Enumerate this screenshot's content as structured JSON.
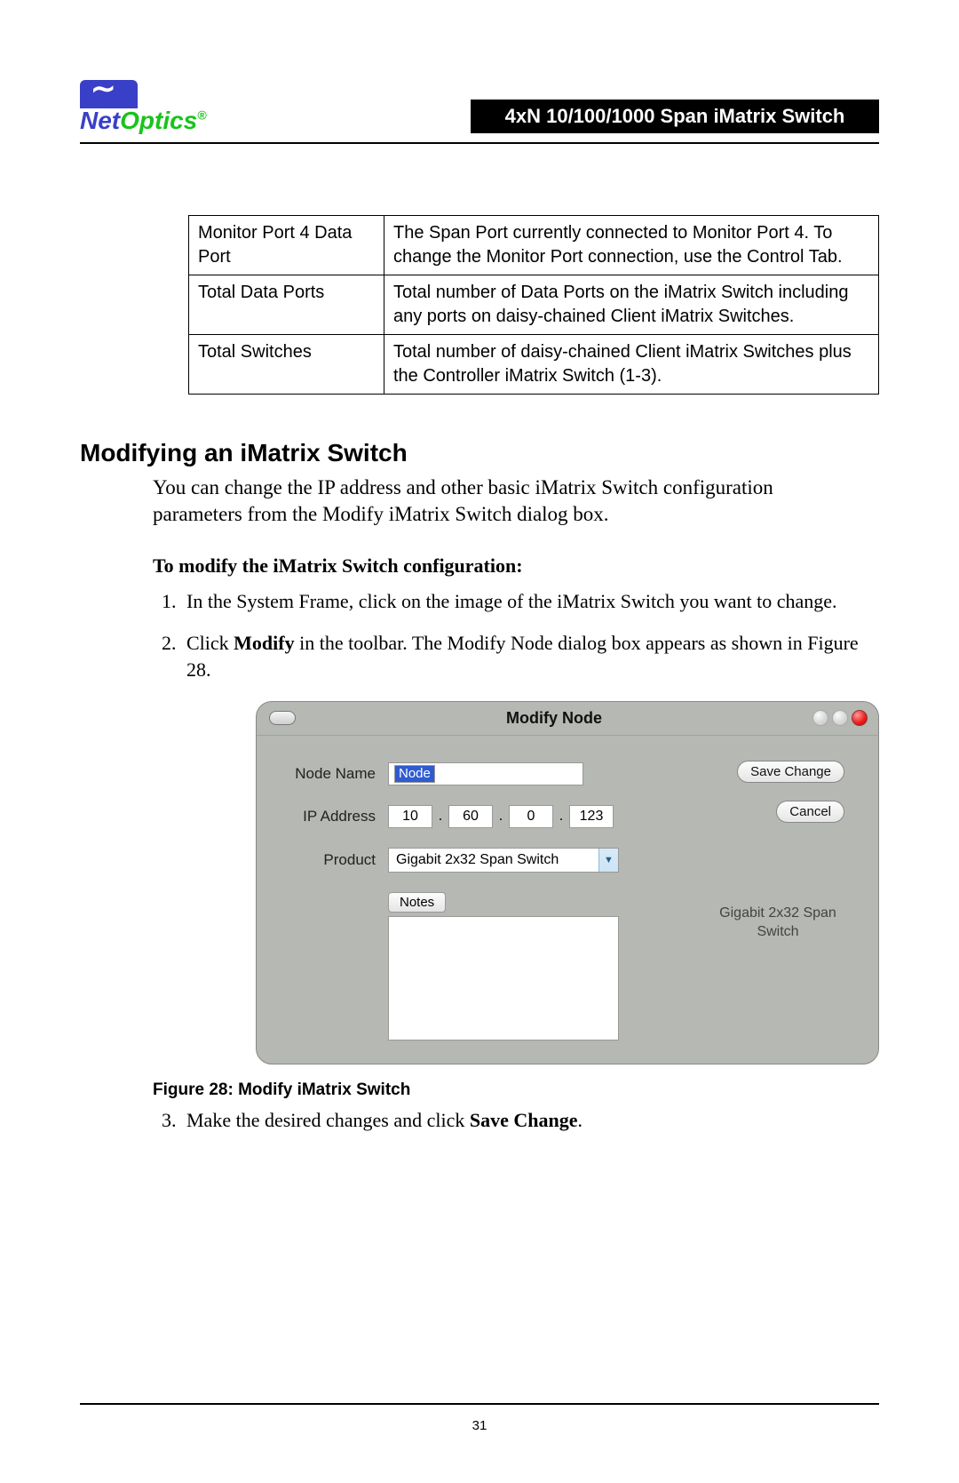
{
  "header": {
    "logo_net": "Net",
    "logo_optics": "Optics",
    "logo_reg": "®",
    "bar_title": "4xN 10/100/1000 Span iMatrix Switch"
  },
  "table": {
    "rows": [
      {
        "left": "Monitor Port 4 Data Port",
        "right": "The Span Port currently connected to Monitor Port 4. To change the Monitor Port connection, use the Control Tab."
      },
      {
        "left": "Total Data Ports",
        "right": "Total number of Data Ports on the iMatrix Switch including any ports on daisy-chained Client iMatrix Switches."
      },
      {
        "left": "Total Switches",
        "right": "Total number of daisy-chained Client iMatrix Switches plus the Controller iMatrix Switch (1-3)."
      }
    ]
  },
  "section_heading": "Modifying an iMatrix Switch",
  "intro_text": "You can change the IP address and other basic iMatrix Switch configuration parameters from the Modify iMatrix Switch dialog box.",
  "sub_heading": "To modify the iMatrix Switch configuration:",
  "steps": {
    "s1": "In the System Frame, click on the image of the iMatrix Switch you want to change.",
    "s2_pre": "Click ",
    "s2_bold": "Modify",
    "s2_post": " in the toolbar. The Modify Node dialog box appears as shown in Figure 28.",
    "s3_pre": "Make the desired changes and click ",
    "s3_bold": "Save Change",
    "s3_post": "."
  },
  "dialog": {
    "title": "Modify Node",
    "labels": {
      "node_name": "Node Name",
      "ip_address": "IP Address",
      "product": "Product",
      "notes": "Notes"
    },
    "node_value": "Node",
    "ip": {
      "a": "10",
      "b": "60",
      "c": "0",
      "d": "123"
    },
    "product_value": "Gigabit 2x32 Span Switch",
    "save_btn": "Save Change",
    "cancel_btn": "Cancel",
    "gig_caption": "Gigabit 2x32 Span Switch"
  },
  "figure": {
    "label_bold": "Figure 28: ",
    "label_rest": "Modify iMatrix Switch"
  },
  "page_number": "31"
}
